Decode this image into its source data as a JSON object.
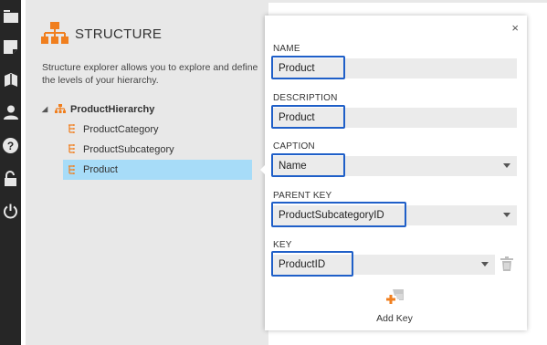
{
  "rail": {
    "icons": [
      "dashboard-icon",
      "notes-icon",
      "book-icon",
      "user-icon",
      "help-icon",
      "unlock-icon",
      "power-icon"
    ]
  },
  "structure": {
    "title": "STRUCTURE",
    "description": "Structure explorer allows you to explore and define the levels of your hierarchy.",
    "tree": {
      "root": "ProductHierarchy",
      "children": [
        "ProductCategory",
        "ProductSubcategory",
        "Product"
      ],
      "selected": "Product"
    }
  },
  "editor": {
    "name_label": "NAME",
    "name_value": "Product",
    "description_label": "DESCRIPTION",
    "description_value": "Product",
    "caption_label": "CAPTION",
    "caption_value": "Name",
    "parent_key_label": "PARENT KEY",
    "parent_key_value": "ProductSubcategoryID",
    "key_label": "KEY",
    "key_value": "ProductID",
    "add_key_label": "Add Key",
    "close_glyph": "×"
  },
  "colors": {
    "accent_orange": "#f07f1f",
    "highlight_border": "#1f5fc8",
    "selection_bg": "#a7dcf8",
    "rail_bg": "#262626"
  }
}
